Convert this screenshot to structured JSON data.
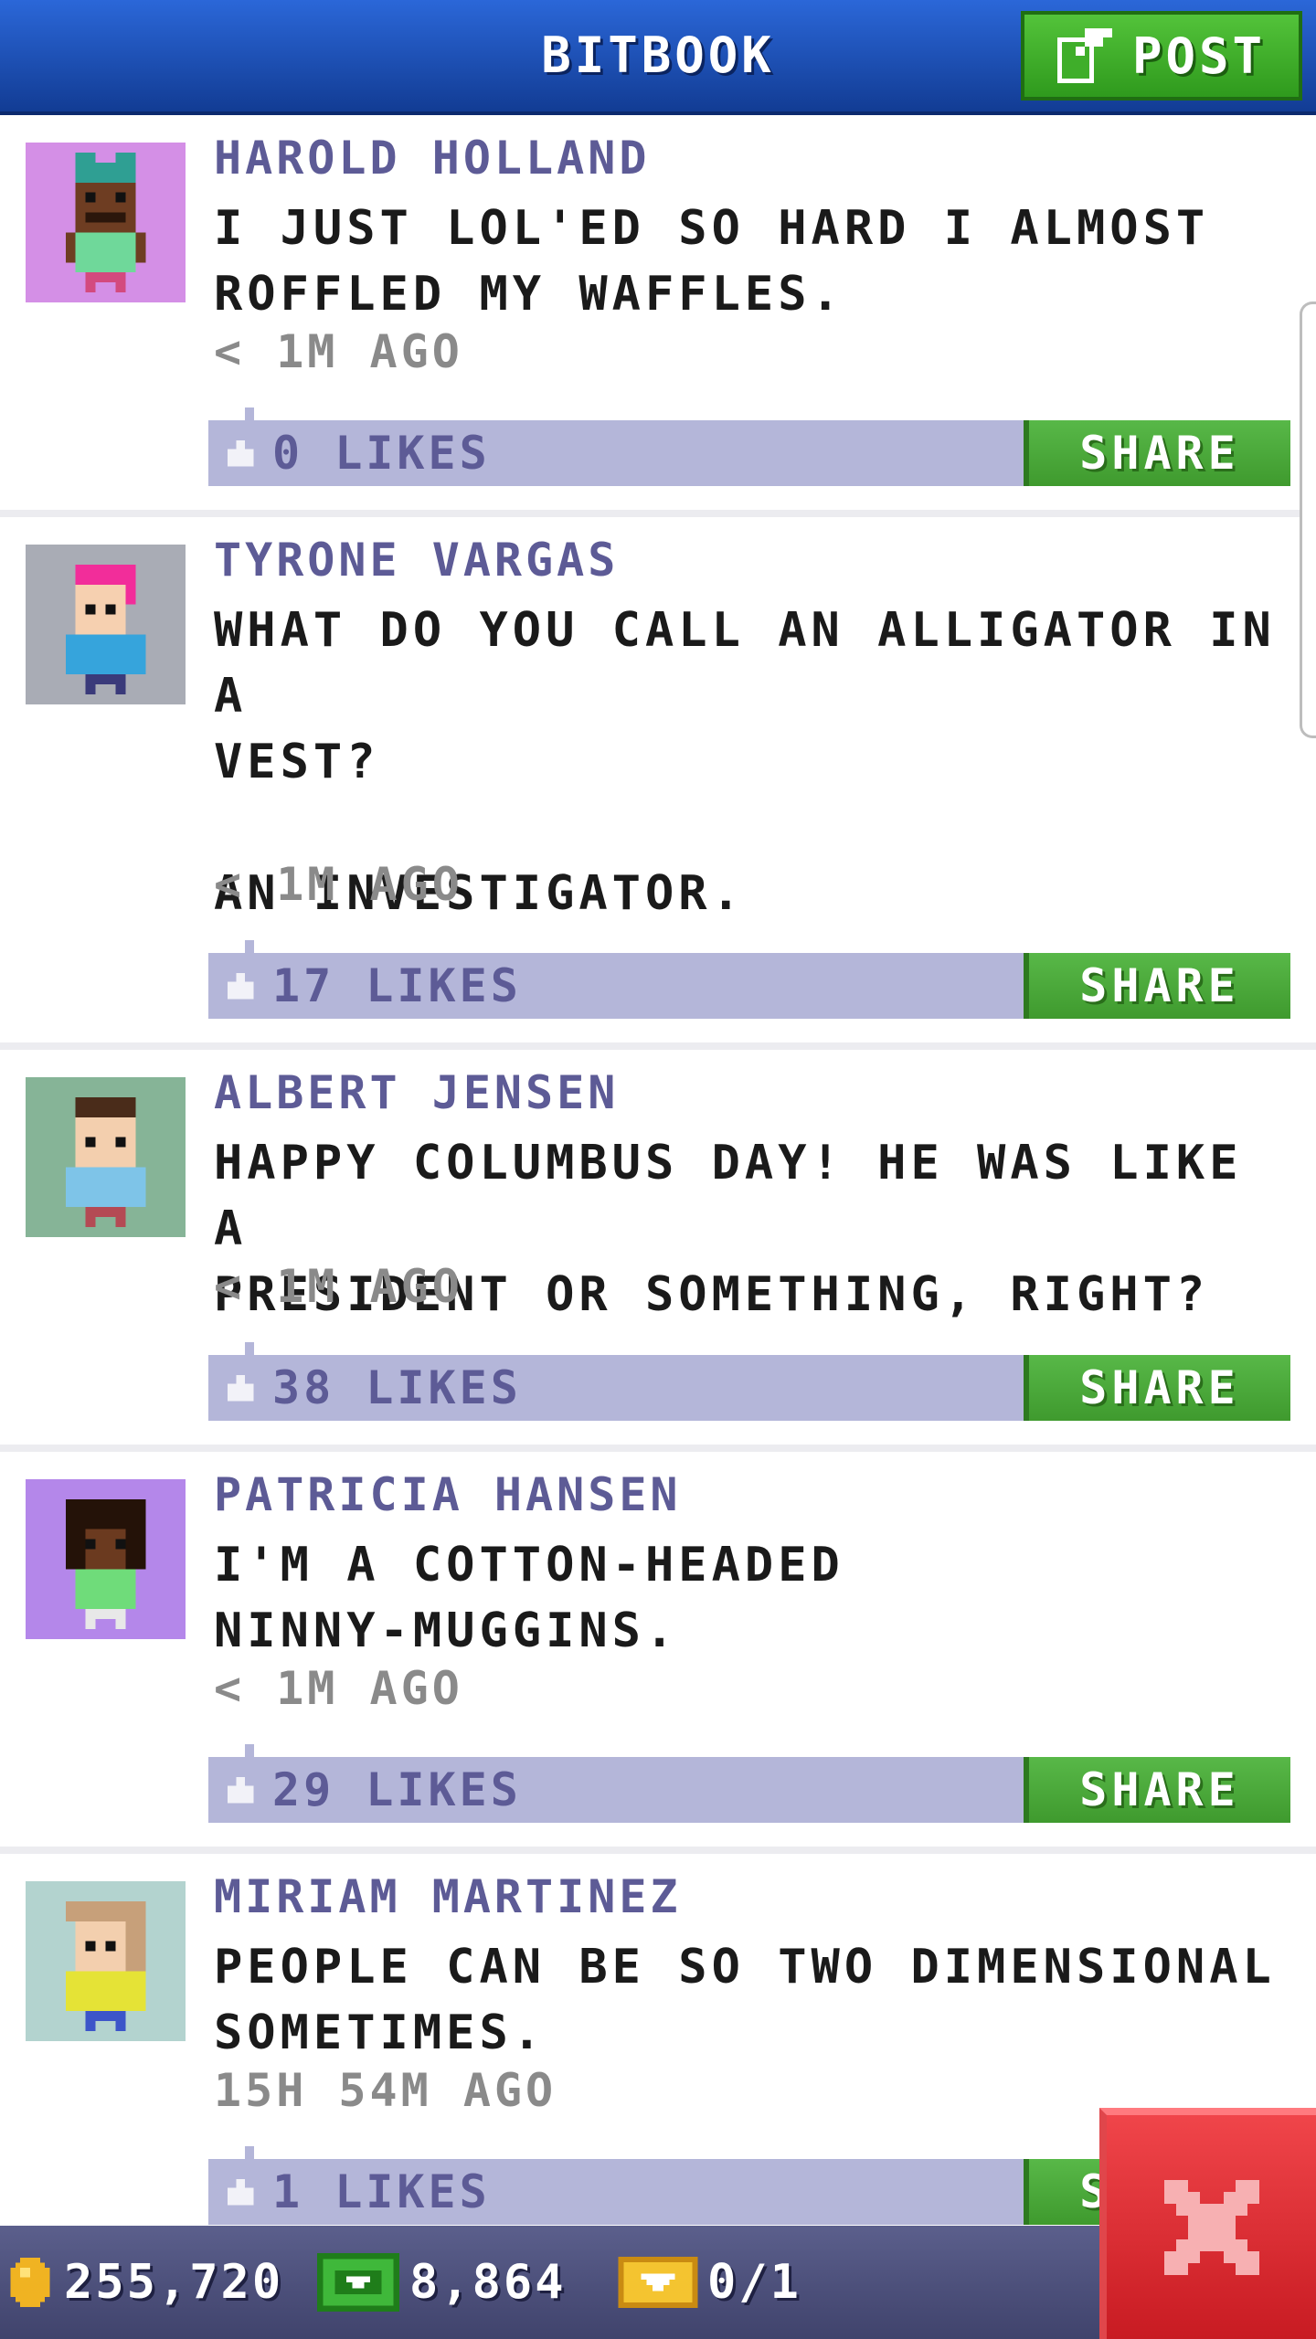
{
  "header": {
    "title": "BITBOOK",
    "post_label": "POST"
  },
  "posts": [
    {
      "author": "HAROLD HOLLAND",
      "text": "I JUST LOL'ED SO HARD I ALMOST\nROFFLED MY WAFFLES.",
      "time": "< 1M AGO",
      "likes": "0 LIKES",
      "share": "SHARE",
      "avatar_bg": "#d48fe6"
    },
    {
      "author": "TYRONE VARGAS",
      "text": "WHAT DO YOU CALL AN ALLIGATOR IN A\nVEST?\n\nAN INVESTIGATOR.",
      "time": "< 1M AGO",
      "likes": "17 LIKES",
      "share": "SHARE",
      "avatar_bg": "#a9acb5"
    },
    {
      "author": "ALBERT JENSEN",
      "text": "HAPPY COLUMBUS DAY! HE WAS LIKE A\nPRESIDENT OR SOMETHING, RIGHT?",
      "time": "< 1M AGO",
      "likes": "38 LIKES",
      "share": "SHARE",
      "avatar_bg": "#86b497"
    },
    {
      "author": "PATRICIA HANSEN",
      "text": "I'M A COTTON-HEADED\nNINNY-MUGGINS.",
      "time": "< 1M AGO",
      "likes": "29 LIKES",
      "share": "SHARE",
      "avatar_bg": "#b487ea"
    },
    {
      "author": "MIRIAM MARTINEZ",
      "text": "PEOPLE CAN BE SO TWO DIMENSIONAL\nSOMETIMES.",
      "time": "15H 54M AGO",
      "likes": "1 LIKES",
      "share": "SHARE",
      "avatar_bg": "#b3d3cf"
    }
  ],
  "footer": {
    "coins": "255,720",
    "bux": "8,864",
    "tickets": "0/1"
  },
  "colors": {
    "header": "#1f4fb8",
    "post_button": "#3fae2a",
    "share_button": "#4aa83a",
    "action_bar": "#b4b6d9",
    "author_text": "#5d5b96",
    "close_button": "#e0262c"
  }
}
